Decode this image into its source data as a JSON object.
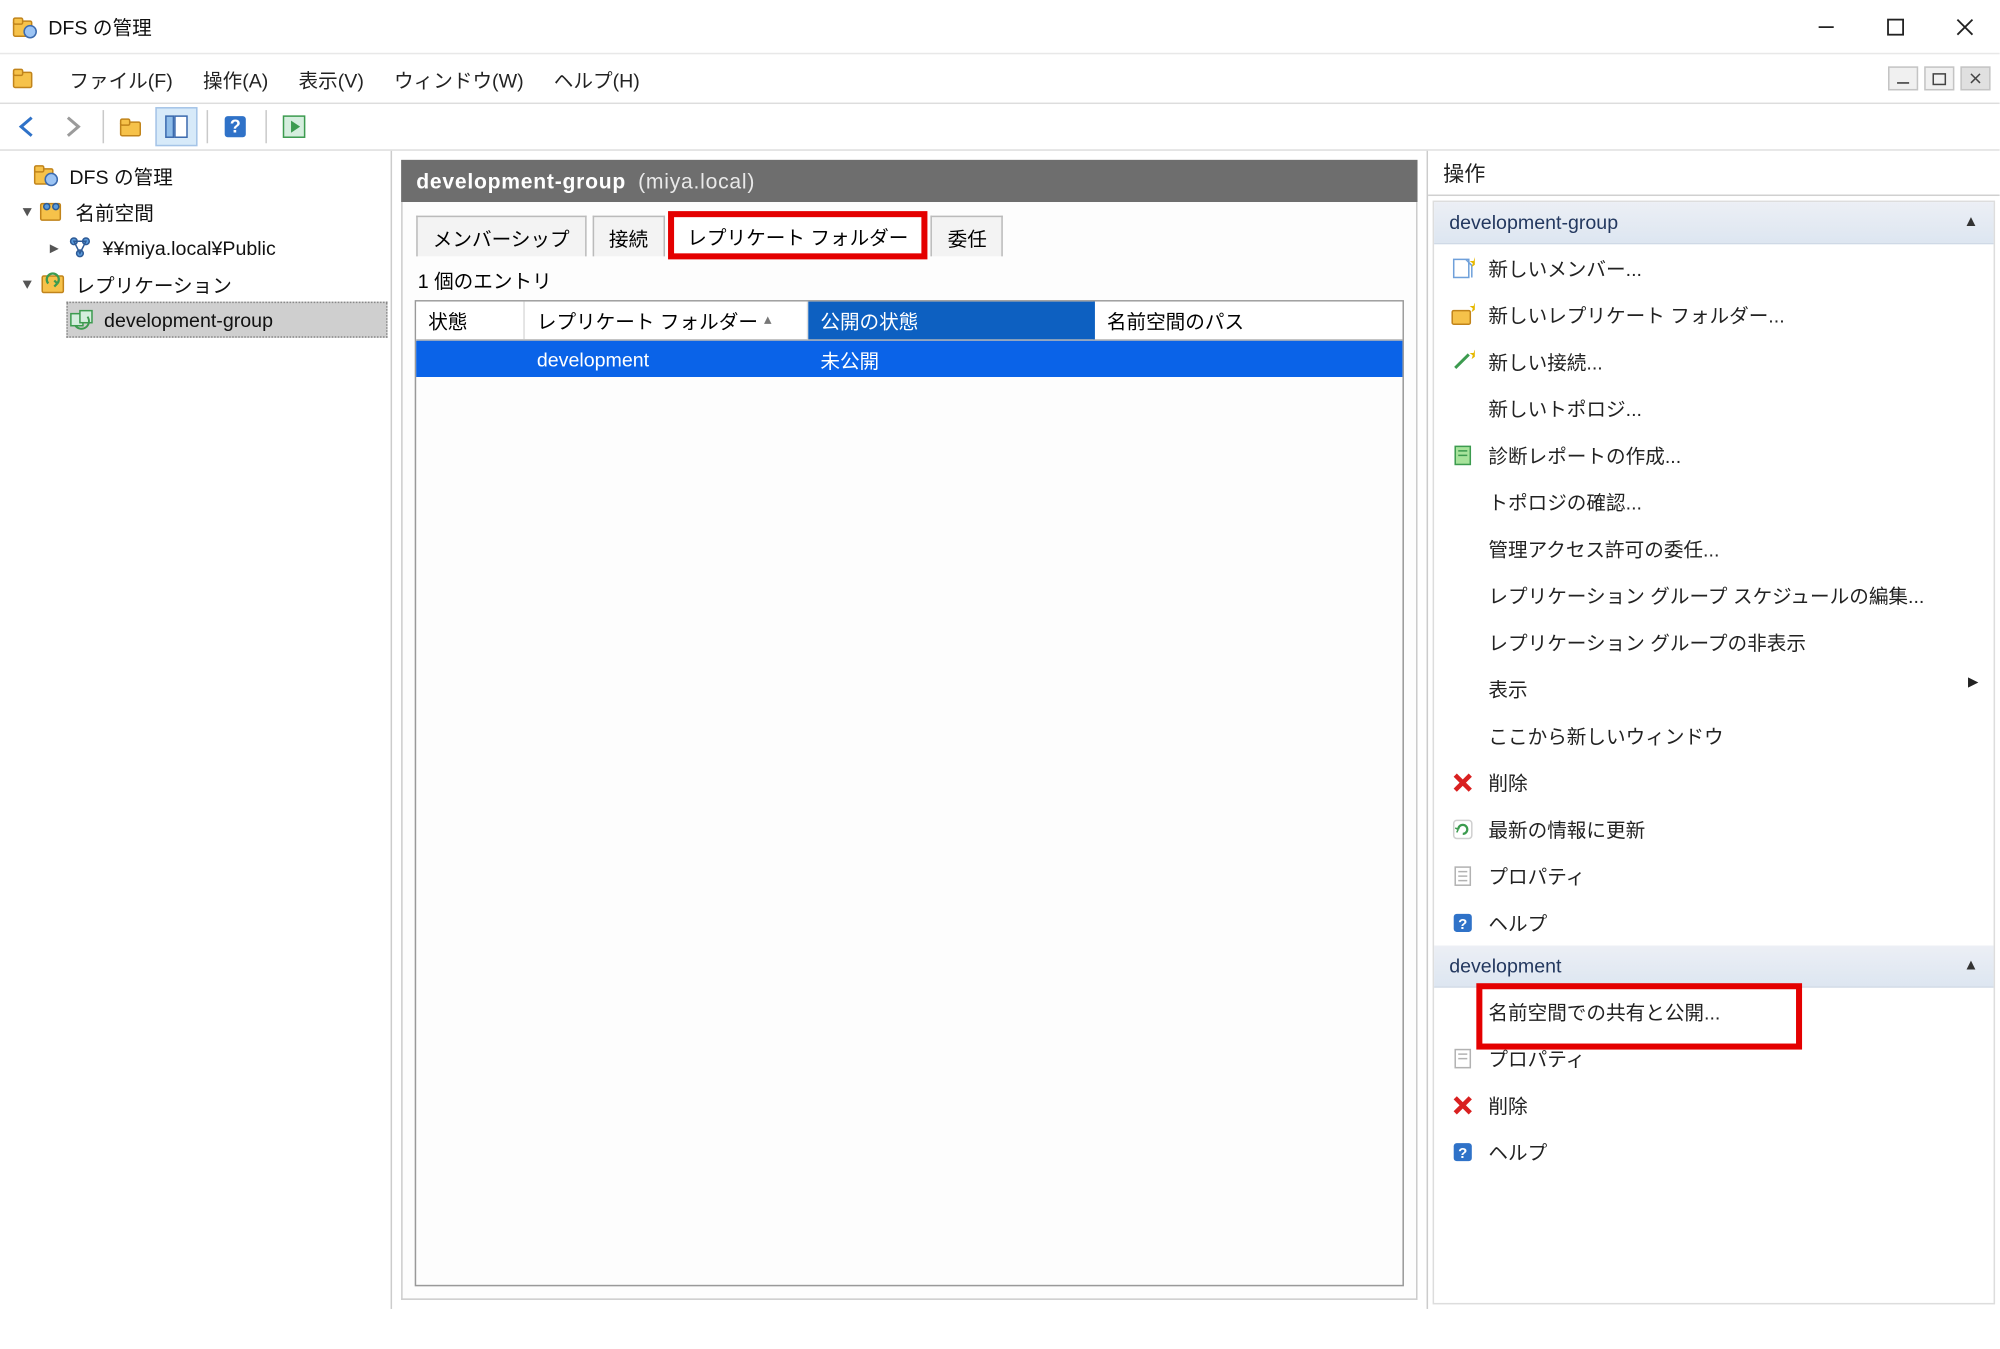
{
  "window": {
    "title": "DFS の管理"
  },
  "menu": {
    "file": "ファイル(F)",
    "action": "操作(A)",
    "view": "表示(V)",
    "window": "ウィンドウ(W)",
    "help": "ヘルプ(H)"
  },
  "tree": {
    "root": "DFS の管理",
    "namespace": "名前空間",
    "namespace_path": "¥¥miya.local¥Public",
    "replication": "レプリケーション",
    "rep_group": "development-group"
  },
  "center": {
    "crumb_main": "development-group",
    "crumb_sub": "(miya.local)",
    "tabs": {
      "membership": "メンバーシップ",
      "connections": "接続",
      "replicated_folders": "レプリケート フォルダー",
      "delegation": "委任"
    },
    "entries": "1 個のエントリ",
    "columns": {
      "state": "状態",
      "replicated_folder": "レプリケート フォルダー",
      "publication_state": "公開の状態",
      "namespace_path": "名前空間のパス"
    },
    "row": {
      "state": "",
      "folder": "development",
      "pub_state": "未公開",
      "ns_path": ""
    }
  },
  "actions": {
    "panel_title": "操作",
    "section1": "development-group",
    "items1": {
      "new_member": "新しいメンバー...",
      "new_rep_folder": "新しいレプリケート フォルダー...",
      "new_connection": "新しい接続...",
      "new_topology": "新しいトポロジ...",
      "create_report": "診断レポートの作成...",
      "verify_topology": "トポロジの確認...",
      "delegate": "管理アクセス許可の委任...",
      "edit_schedule": "レプリケーション グループ スケジュールの編集...",
      "hide_group": "レプリケーション グループの非表示",
      "view": "表示",
      "new_window": "ここから新しいウィンドウ",
      "delete": "削除",
      "refresh": "最新の情報に更新",
      "properties": "プロパティ",
      "help": "ヘルプ"
    },
    "section2": "development",
    "items2": {
      "share_publish": "名前空間での共有と公開...",
      "properties": "プロパティ",
      "delete": "削除",
      "help": "ヘルプ"
    }
  }
}
